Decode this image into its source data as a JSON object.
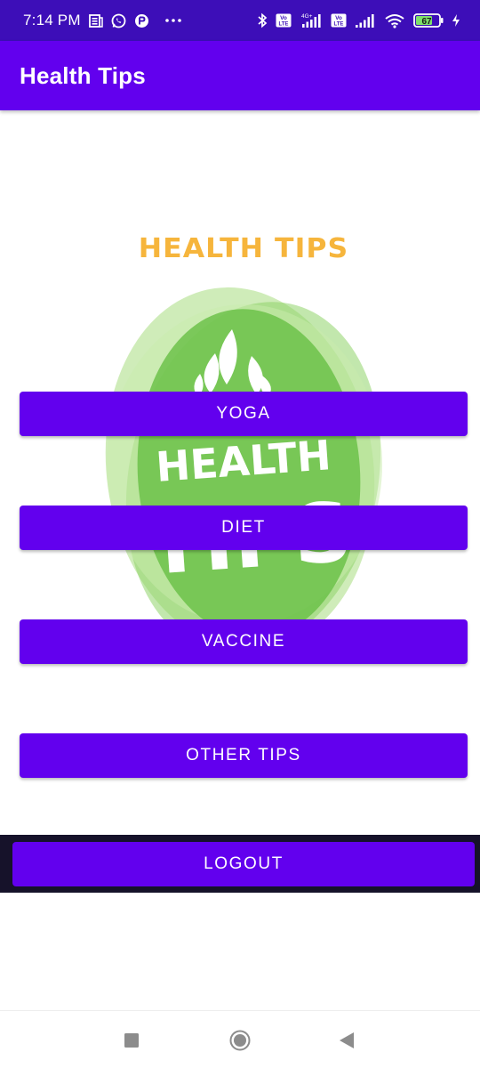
{
  "status_bar": {
    "time": "7:14 PM",
    "battery": "67",
    "icons": [
      "news-icon",
      "whatsapp-icon",
      "app-icon",
      "more-dots-icon",
      "bluetooth-icon",
      "volte-icon",
      "signal-icon",
      "wifi-icon",
      "battery-icon",
      "charging-icon"
    ],
    "network_label": "4G+",
    "volte_label": "Vo LTE"
  },
  "app_bar": {
    "title": "Health Tips"
  },
  "hero": {
    "title": "HEALTH TIPS",
    "image_text_line1": "HEALTH",
    "image_text_line2": "TIPS",
    "colors": {
      "title": "#f6b53c",
      "leaf_green": "#6cc24a",
      "light_green": "#a7dd7f"
    }
  },
  "buttons": {
    "yoga": "YOGA",
    "diet": "DIET",
    "vaccine": "VACCINE",
    "other_tips": "OTHER TIPS",
    "logout": "LOGOUT"
  },
  "nav_bar": {
    "icons": [
      "recents-square-icon",
      "home-circle-icon",
      "back-triangle-icon"
    ]
  },
  "colors": {
    "primary": "#6200ee",
    "status_bar": "#3d0eb8",
    "logout_bar": "#16122a"
  }
}
